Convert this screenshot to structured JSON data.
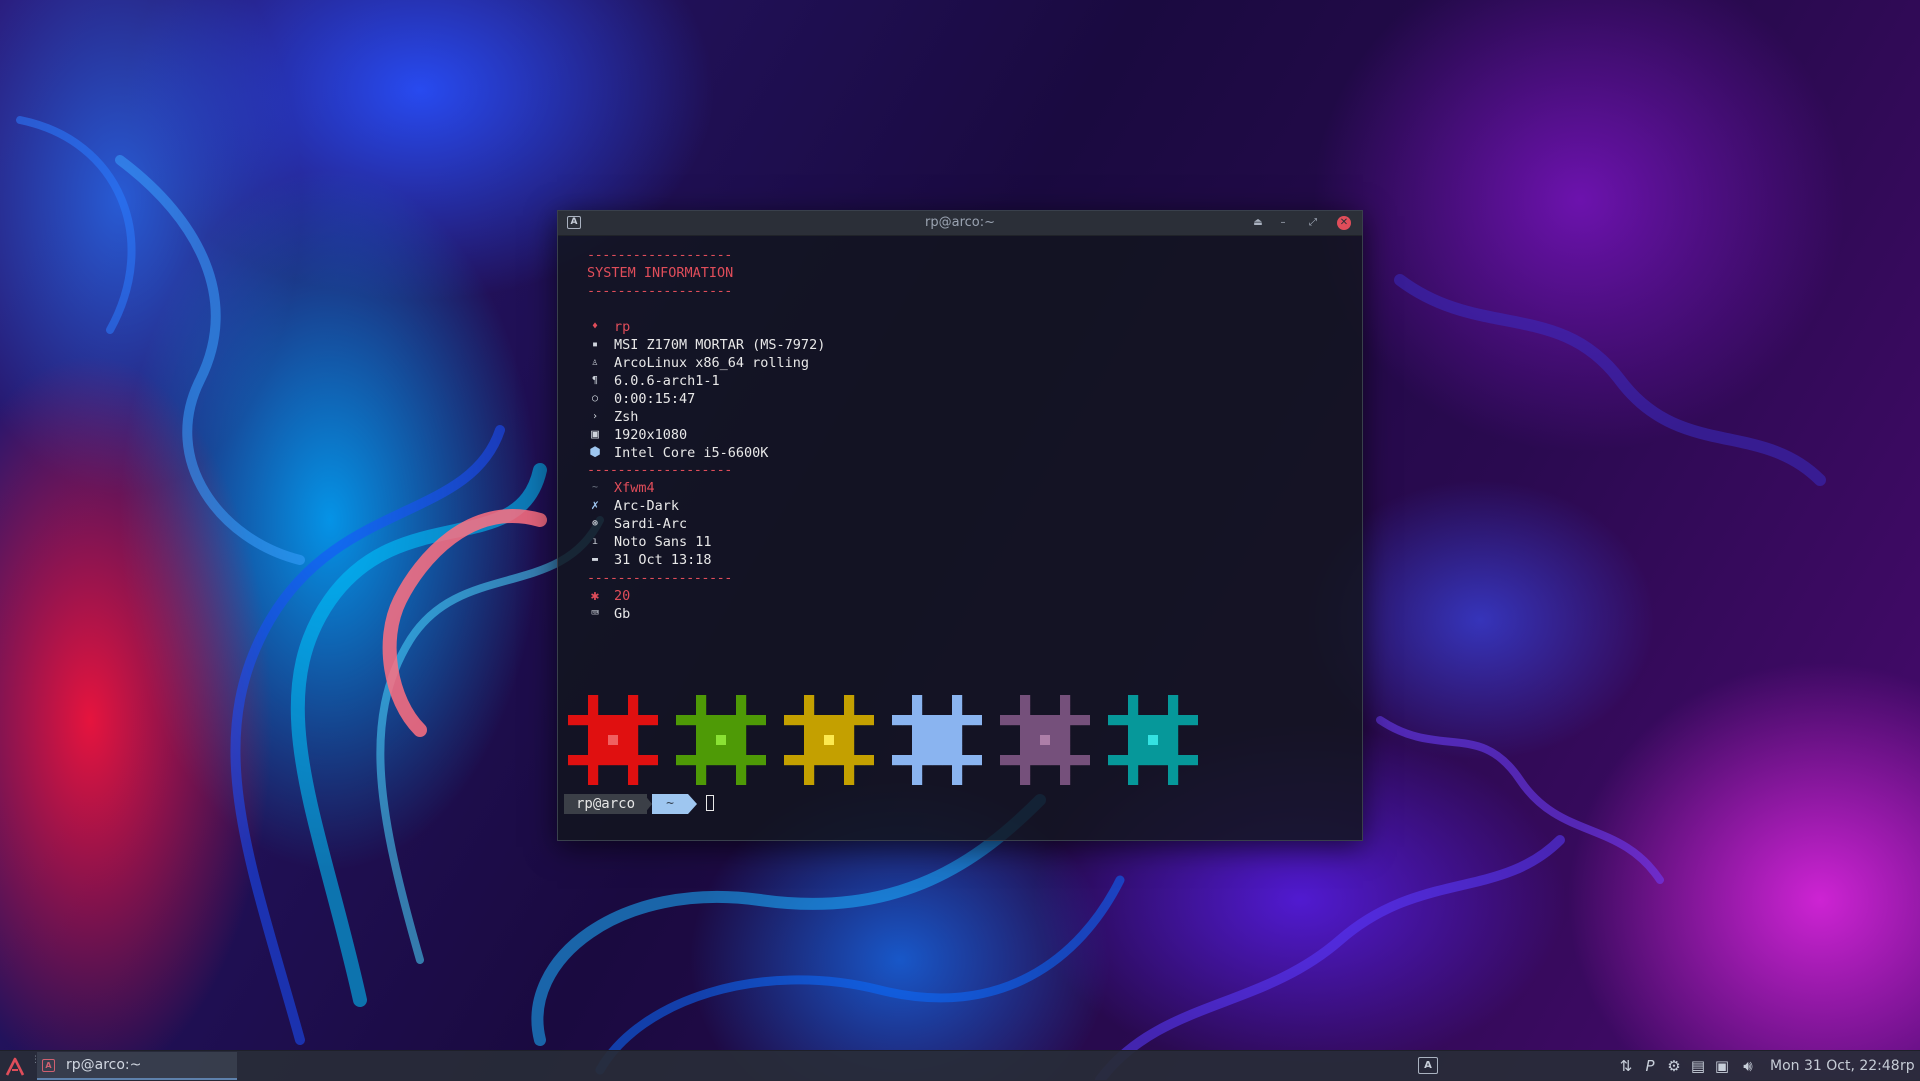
{
  "window": {
    "title": "rp@arco:~",
    "app_icon": "arcolinux-terminal-icon",
    "buttons": [
      "shade",
      "minimize",
      "maximize",
      "close"
    ]
  },
  "terminal": {
    "separator": "-------------------",
    "header": "SYSTEM INFORMATION",
    "info": [
      {
        "icon": "user-icon",
        "value": "rp"
      },
      {
        "icon": "host-icon",
        "value": "MSI Z170M MORTAR (MS-7972)"
      },
      {
        "icon": "os-icon",
        "value": "ArcoLinux x86_64 rolling"
      },
      {
        "icon": "kernel-icon",
        "value": "6.0.6-arch1-1"
      },
      {
        "icon": "uptime-icon",
        "value": "0:00:15:47"
      },
      {
        "icon": "shell-icon",
        "value": "Zsh"
      },
      {
        "icon": "resolution-icon",
        "value": "1920x1080"
      },
      {
        "icon": "cpu-icon",
        "value": "Intel Core i5-6600K"
      }
    ],
    "info2": [
      {
        "icon": "de-icon",
        "value": "Xfwm4"
      },
      {
        "icon": "theme-icon",
        "value": "Arc-Dark"
      },
      {
        "icon": "icons-icon",
        "value": "Sardi-Arc"
      },
      {
        "icon": "font-icon",
        "value": "Noto Sans 11"
      },
      {
        "icon": "date-icon",
        "value": "31 Oct 13:18"
      }
    ],
    "info3": [
      {
        "icon": "asterisk-icon",
        "value": "20"
      },
      {
        "icon": "keyboard-icon",
        "value": "Gb"
      }
    ],
    "color_blocks": [
      {
        "name": "red",
        "color": "#e01010",
        "center": "#f06060"
      },
      {
        "name": "green",
        "color": "#4e9a06",
        "center": "#8ae234"
      },
      {
        "name": "yellow",
        "color": "#c4a000",
        "center": "#fce94f"
      },
      {
        "name": "blue",
        "color": "#8ab4f0",
        "center": "#8ab4f0"
      },
      {
        "name": "magenta",
        "color": "#75507b",
        "center": "#ad7fa8"
      },
      {
        "name": "cyan",
        "color": "#06989a",
        "center": "#34e2e2"
      }
    ],
    "prompt": {
      "user": "rp@arco",
      "dir": "~"
    }
  },
  "taskbar": {
    "task_label": "rp@arco:~",
    "workspace_label": "A",
    "clock": "Mon 31 Oct, 22:48",
    "user": "rp"
  },
  "colors": {
    "accent_red": "#e04d5a",
    "prompt_blue": "#9ec6f0",
    "taskbar_bg": "#282c38"
  }
}
